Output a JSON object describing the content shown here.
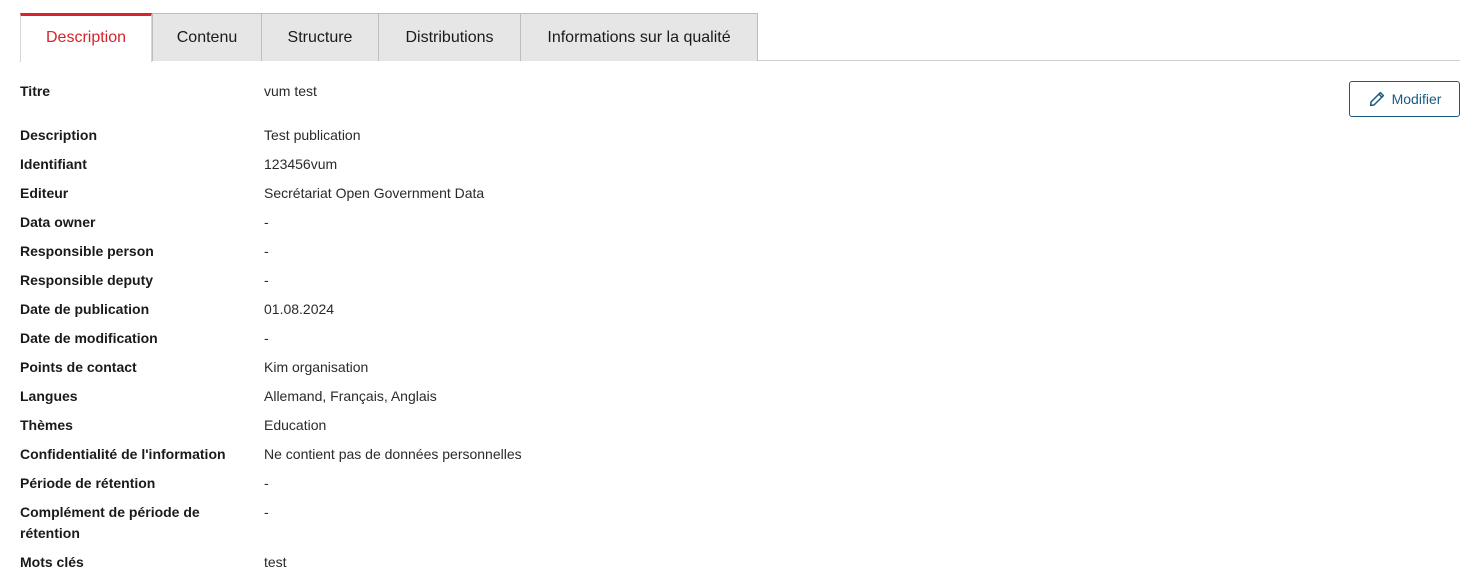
{
  "tabs": [
    {
      "label": "Description",
      "active": true
    },
    {
      "label": "Contenu",
      "active": false
    },
    {
      "label": "Structure",
      "active": false
    },
    {
      "label": "Distributions",
      "active": false
    },
    {
      "label": "Informations sur la qualité",
      "active": false
    }
  ],
  "actions": {
    "modify_label": "Modifier",
    "modify_icon": "pencil-icon"
  },
  "colors": {
    "accent_red": "#d8232a",
    "button_blue": "#1a5a82",
    "inactive_tab_bg": "#e6e6e6"
  },
  "fields": [
    {
      "label": "Titre",
      "value": "vum test"
    },
    {
      "label": "Description",
      "value": "Test publication"
    },
    {
      "label": "Identifiant",
      "value": "123456vum"
    },
    {
      "label": "Editeur",
      "value": "Secrétariat Open Government Data"
    },
    {
      "label": "Data owner",
      "value": "-"
    },
    {
      "label": "Responsible person",
      "value": "-"
    },
    {
      "label": "Responsible deputy",
      "value": "-"
    },
    {
      "label": "Date de publication",
      "value": "01.08.2024"
    },
    {
      "label": "Date de modification",
      "value": "-"
    },
    {
      "label": "Points de contact",
      "value": "Kim organisation"
    },
    {
      "label": "Langues",
      "value": "Allemand, Français, Anglais"
    },
    {
      "label": "Thèmes",
      "value": "Education"
    },
    {
      "label": "Confidentialité de l'information",
      "value": "Ne contient pas de données personnelles"
    },
    {
      "label": "Période de rétention",
      "value": "-"
    },
    {
      "label": "Complément de période de rétention",
      "value": "-"
    },
    {
      "label": "Mots clés",
      "value": "test"
    }
  ]
}
